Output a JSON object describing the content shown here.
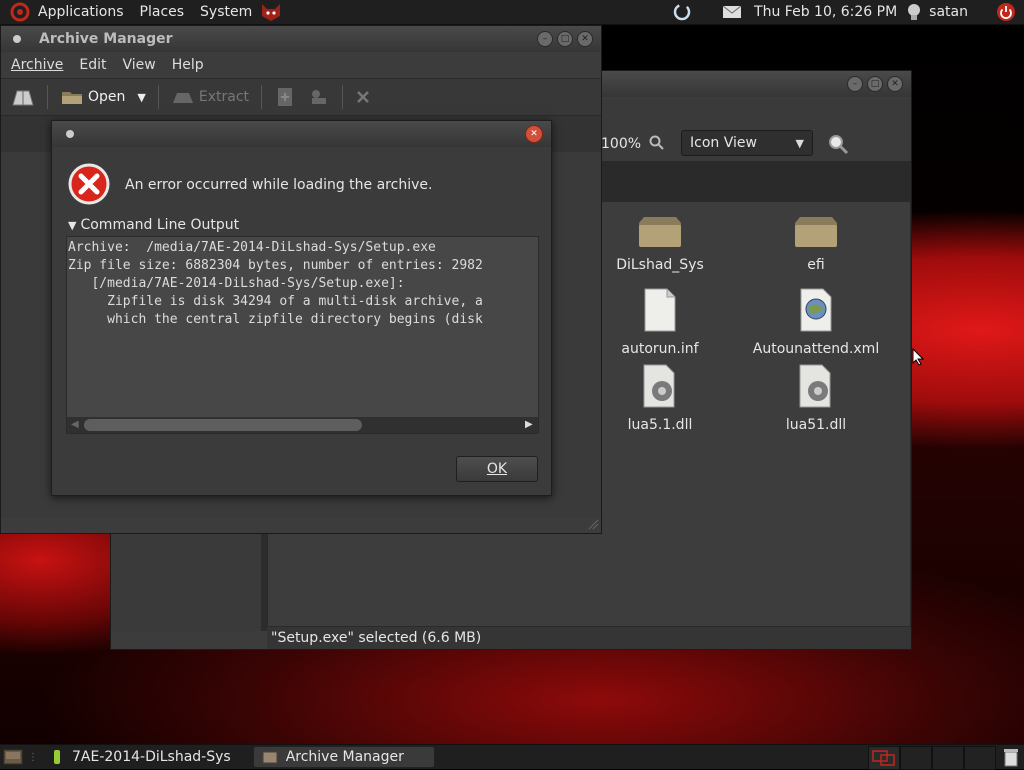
{
  "top_panel": {
    "menus": [
      "Applications",
      "Places",
      "System"
    ],
    "datetime": "Thu Feb 10, 6:26 PM",
    "user": "satan"
  },
  "file_manager": {
    "zoom": "100%",
    "view_select": "Icon View",
    "status": "\"Setup.exe\" selected (6.6 MB)",
    "files": [
      {
        "name": "DiLshad_Sys",
        "icon": "folder-icon"
      },
      {
        "name": "efi",
        "icon": "folder-icon"
      },
      {
        "name": "autorun.inf",
        "icon": "document-icon"
      },
      {
        "name": "Autounattend.xml",
        "icon": "xml-document-icon"
      },
      {
        "name": "lua5.1.dll",
        "icon": "library-icon"
      },
      {
        "name": "lua51.dll",
        "icon": "library-icon"
      }
    ]
  },
  "archive_manager": {
    "title": "Archive Manager",
    "menu": [
      "Archive",
      "Edit",
      "View",
      "Help"
    ],
    "toolbar": {
      "open": "Open",
      "extract": "Extract"
    }
  },
  "error_dialog": {
    "message": "An error occurred while loading the archive.",
    "expander": "Command Line Output",
    "output_lines": [
      "Archive:  /media/7AE-2014-DiLshad-Sys/Setup.exe",
      "Zip file size: 6882304 bytes, number of entries: 2982",
      "",
      "   [/media/7AE-2014-DiLshad-Sys/Setup.exe]:",
      "     Zipfile is disk 34294 of a multi-disk archive, a",
      "     which the central zipfile directory begins (disk"
    ],
    "ok": "OK"
  },
  "bottom_panel": {
    "tasks": [
      "7AE-2014-DiLshad-Sys",
      "Archive Manager"
    ]
  },
  "colors": {
    "accent_red": "#c0281c",
    "panel": "#1f1f1f"
  }
}
